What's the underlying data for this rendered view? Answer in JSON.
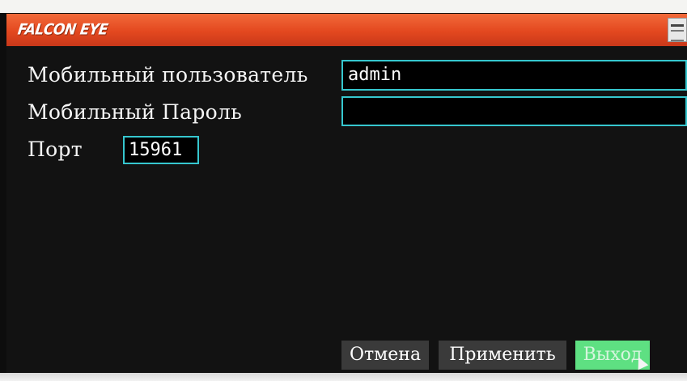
{
  "header": {
    "brand": "FALCON EYE",
    "menu_icon": "window-menu-icon"
  },
  "form": {
    "user_label": "Мобильный пользователь",
    "user_value": "admin",
    "password_label": "Мобильный Пароль",
    "password_value": "",
    "port_label": "Порт",
    "port_value": "15961"
  },
  "buttons": {
    "cancel": "Отмена",
    "apply": "Применить",
    "exit": "Выход"
  },
  "colors": {
    "title_bar": "#e3481f",
    "field_border": "#36c7cf",
    "exit_highlight": "#5ee082",
    "button_bg": "#3a3a3a"
  },
  "focused_button": "exit"
}
